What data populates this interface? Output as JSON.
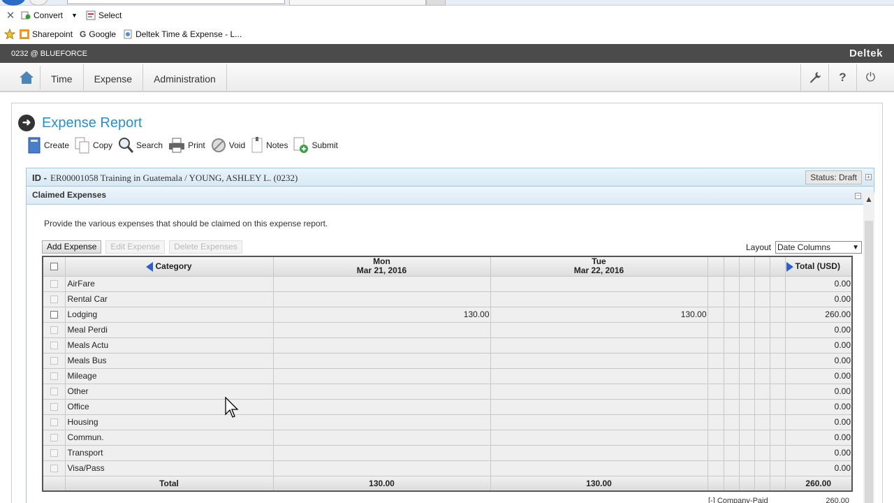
{
  "browser": {
    "commands": [
      {
        "label": "Convert",
        "icon": "convert-icon"
      },
      {
        "label": "Select",
        "icon": "select-icon"
      }
    ],
    "favorites": [
      {
        "label": "Sharepoint",
        "icon": "sharepoint-icon"
      },
      {
        "label": "Google",
        "icon": "google-icon"
      },
      {
        "label": "Deltek Time & Expense - L...",
        "icon": "page-icon"
      }
    ]
  },
  "header": {
    "context": "0232 @ BLUEFORCE",
    "brand": "Deltek"
  },
  "nav": {
    "items": [
      "Time",
      "Expense",
      "Administration"
    ]
  },
  "page": {
    "title": "Expense Report",
    "toolbar": [
      {
        "label": "Create",
        "icon": "create-icon"
      },
      {
        "label": "Copy",
        "icon": "copy-icon"
      },
      {
        "label": "Search",
        "icon": "search-icon"
      },
      {
        "label": "Print",
        "icon": "print-icon"
      },
      {
        "label": "Void",
        "icon": "void-icon"
      },
      {
        "label": "Notes",
        "icon": "notes-icon"
      },
      {
        "label": "Submit",
        "icon": "submit-icon"
      }
    ],
    "id_label": "ID -",
    "id_text": "ER00001058  Training in Guatemala / YOUNG, ASHLEY L. (0232)",
    "status": "Status:  Draft"
  },
  "section": {
    "title": "Claimed Expenses",
    "instructions": "Provide the various expenses that should be claimed on this expense report.",
    "buttons": {
      "add": "Add Expense",
      "edit": "Edit Expense",
      "delete": "Delete Expenses"
    },
    "layout_label": "Layout",
    "layout_value": "Date Columns"
  },
  "grid": {
    "headers": {
      "category": "Category",
      "mon_day": "Mon",
      "mon_date": "Mar 21, 2016",
      "tue_day": "Tue",
      "tue_date": "Mar 22, 2016",
      "total": "Total (USD)"
    },
    "rows": [
      {
        "category": "AirFare",
        "mon": "",
        "tue": "",
        "total": "0.00"
      },
      {
        "category": "Rental Car",
        "mon": "",
        "tue": "",
        "total": "0.00"
      },
      {
        "category": "Lodging",
        "mon": "130.00",
        "tue": "130.00",
        "total": "260.00"
      },
      {
        "category": "Meal Perdi",
        "mon": "",
        "tue": "",
        "total": "0.00"
      },
      {
        "category": "Meals Actu",
        "mon": "",
        "tue": "",
        "total": "0.00"
      },
      {
        "category": "Meals Bus",
        "mon": "",
        "tue": "",
        "total": "0.00"
      },
      {
        "category": "Mileage",
        "mon": "",
        "tue": "",
        "total": "0.00"
      },
      {
        "category": "Other",
        "mon": "",
        "tue": "",
        "total": "0.00"
      },
      {
        "category": "Office",
        "mon": "",
        "tue": "",
        "total": "0.00"
      },
      {
        "category": "Housing",
        "mon": "",
        "tue": "",
        "total": "0.00"
      },
      {
        "category": "Commun.",
        "mon": "",
        "tue": "",
        "total": "0.00"
      },
      {
        "category": "Transport",
        "mon": "",
        "tue": "",
        "total": "0.00"
      },
      {
        "category": "Visa/Pass",
        "mon": "",
        "tue": "",
        "total": "0.00"
      }
    ],
    "footer": {
      "label": "Total",
      "mon": "130.00",
      "tue": "130.00",
      "total": "260.00"
    },
    "company_paid_label": "[-] Company-Paid",
    "company_paid_value": "260.00"
  }
}
